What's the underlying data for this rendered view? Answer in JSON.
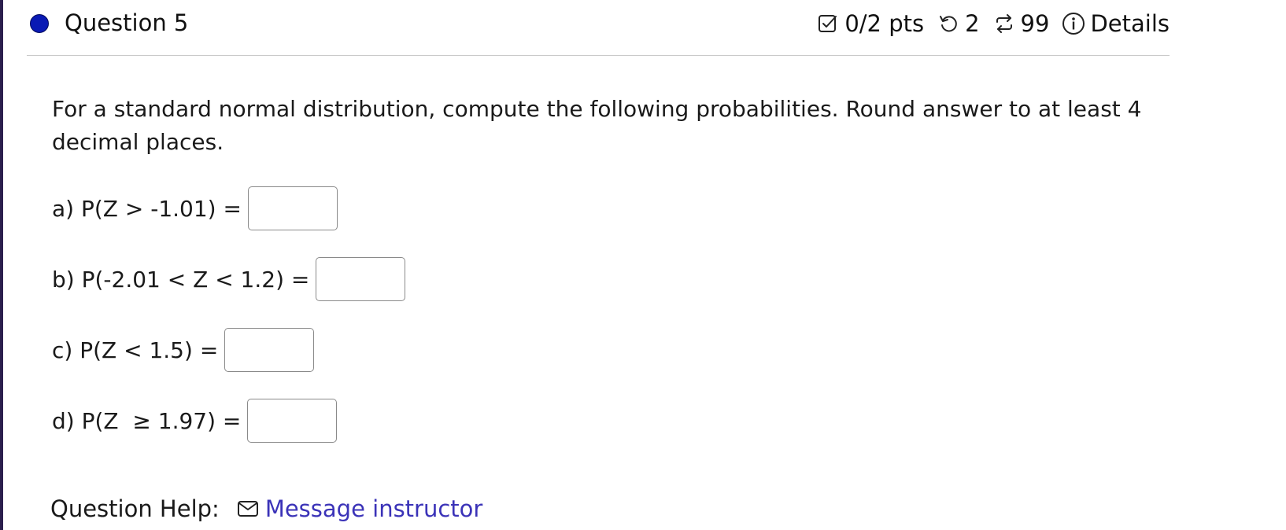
{
  "question": {
    "title": "Question 5",
    "status_color": "#0a1ab4"
  },
  "meta": {
    "points": "0/2 pts",
    "retries": "2",
    "attempts": "99",
    "details_label": "Details",
    "icons": [
      "checkbox-icon",
      "retry-icon",
      "repeat-icon",
      "info-icon"
    ]
  },
  "prompt": {
    "text": "For a standard normal distribution, compute the following probabilities. Round answer to at least 4 decimal places."
  },
  "parts": [
    {
      "label": "a) P(Z > -1.01) =",
      "value": ""
    },
    {
      "label": "b) P(-2.01 < Z < 1.2) =",
      "value": ""
    },
    {
      "label": "c) P(Z < 1.5) =",
      "value": ""
    },
    {
      "label": "d) P(Z  ≥ 1.97) =",
      "value": ""
    }
  ],
  "help": {
    "label": "Question Help:",
    "link_label": "Message instructor",
    "link_color": "#3b33b8"
  }
}
